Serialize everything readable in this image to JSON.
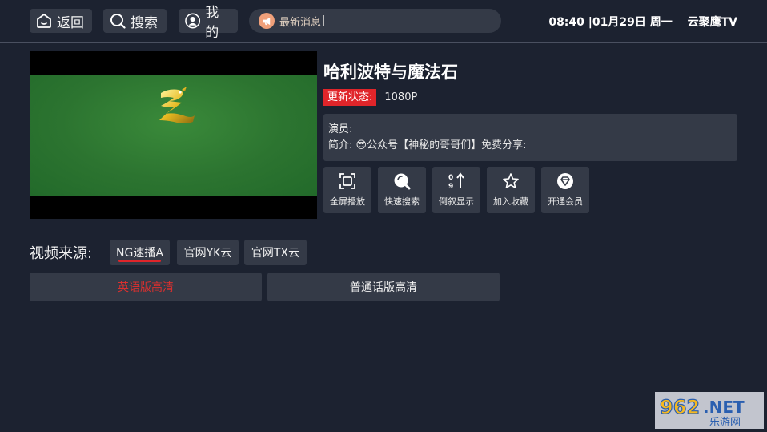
{
  "topbar": {
    "back_label": "返回",
    "search_label": "搜索",
    "mine_label": "我的",
    "news_label": "最新消息",
    "time": "08:40",
    "date": "|01月29日 周一",
    "app_name": "云聚鹰TV"
  },
  "movie": {
    "title": "哈利波特与魔法石",
    "status_tag": "更新状态:",
    "status_value": "1080P",
    "actors_label": "演员:",
    "intro": "简介: 😎公众号【神秘的哥哥们】免费分享:"
  },
  "actions": [
    {
      "label": "全屏播放",
      "icon": "fullscreen-icon"
    },
    {
      "label": "快速搜索",
      "icon": "quick-search-icon"
    },
    {
      "label": "倒叙显示",
      "icon": "sort-order-icon"
    },
    {
      "label": "加入收藏",
      "icon": "star-icon"
    },
    {
      "label": "开通会员",
      "icon": "vip-diamond-icon"
    }
  ],
  "sources": {
    "label": "视频来源:",
    "tabs": [
      "NG速播A",
      "官网YK云",
      "官网TX云"
    ],
    "selected": "NG速播A"
  },
  "episodes": [
    "英语版高清",
    "普通话版高清"
  ],
  "watermark": {
    "text": "962.NET",
    "subtext": "乐游网"
  },
  "colors": {
    "background": "#1c2230",
    "panel": "#343a47",
    "accent_red": "#e0252a",
    "news_icon": "#f0a07a"
  }
}
